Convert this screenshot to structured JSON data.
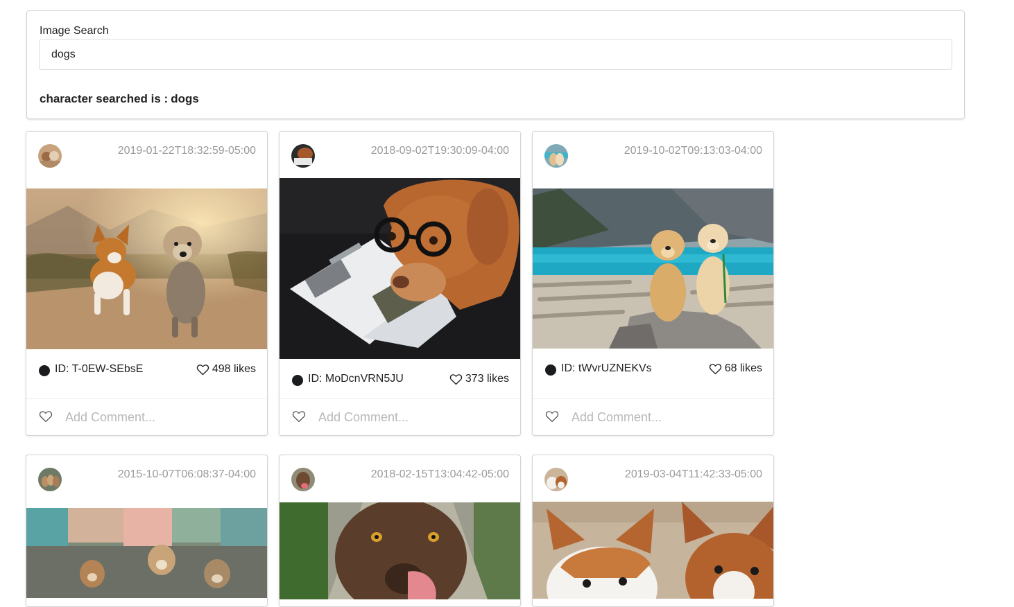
{
  "search": {
    "label": "Image Search",
    "value": "dogs",
    "result_prefix": "character searched is :",
    "result_value": "dogs"
  },
  "comment_placeholder": "Add Comment...",
  "cards": [
    {
      "timestamp": "2019-01-22T18:32:59-05:00",
      "id": "ID: T-0EW-SEbsE",
      "likes": "498 likes"
    },
    {
      "timestamp": "2018-09-02T19:30:09-04:00",
      "id": "ID: MoDcnVRN5JU",
      "likes": "373 likes"
    },
    {
      "timestamp": "2019-10-02T09:13:03-04:00",
      "id": "ID: tWvrUZNEKVs",
      "likes": "68 likes"
    },
    {
      "timestamp": "2015-10-07T06:08:37-04:00"
    },
    {
      "timestamp": "2018-02-15T13:04:42-05:00"
    },
    {
      "timestamp": "2019-03-04T11:42:33-05:00"
    }
  ],
  "icons": {
    "heart": "heart-outline-icon",
    "dot": "filled-circle"
  },
  "colors": {
    "text": "#212121",
    "muted": "#9a9a9a",
    "placeholder": "#b8b8b8",
    "border": "#d4d4d5"
  }
}
